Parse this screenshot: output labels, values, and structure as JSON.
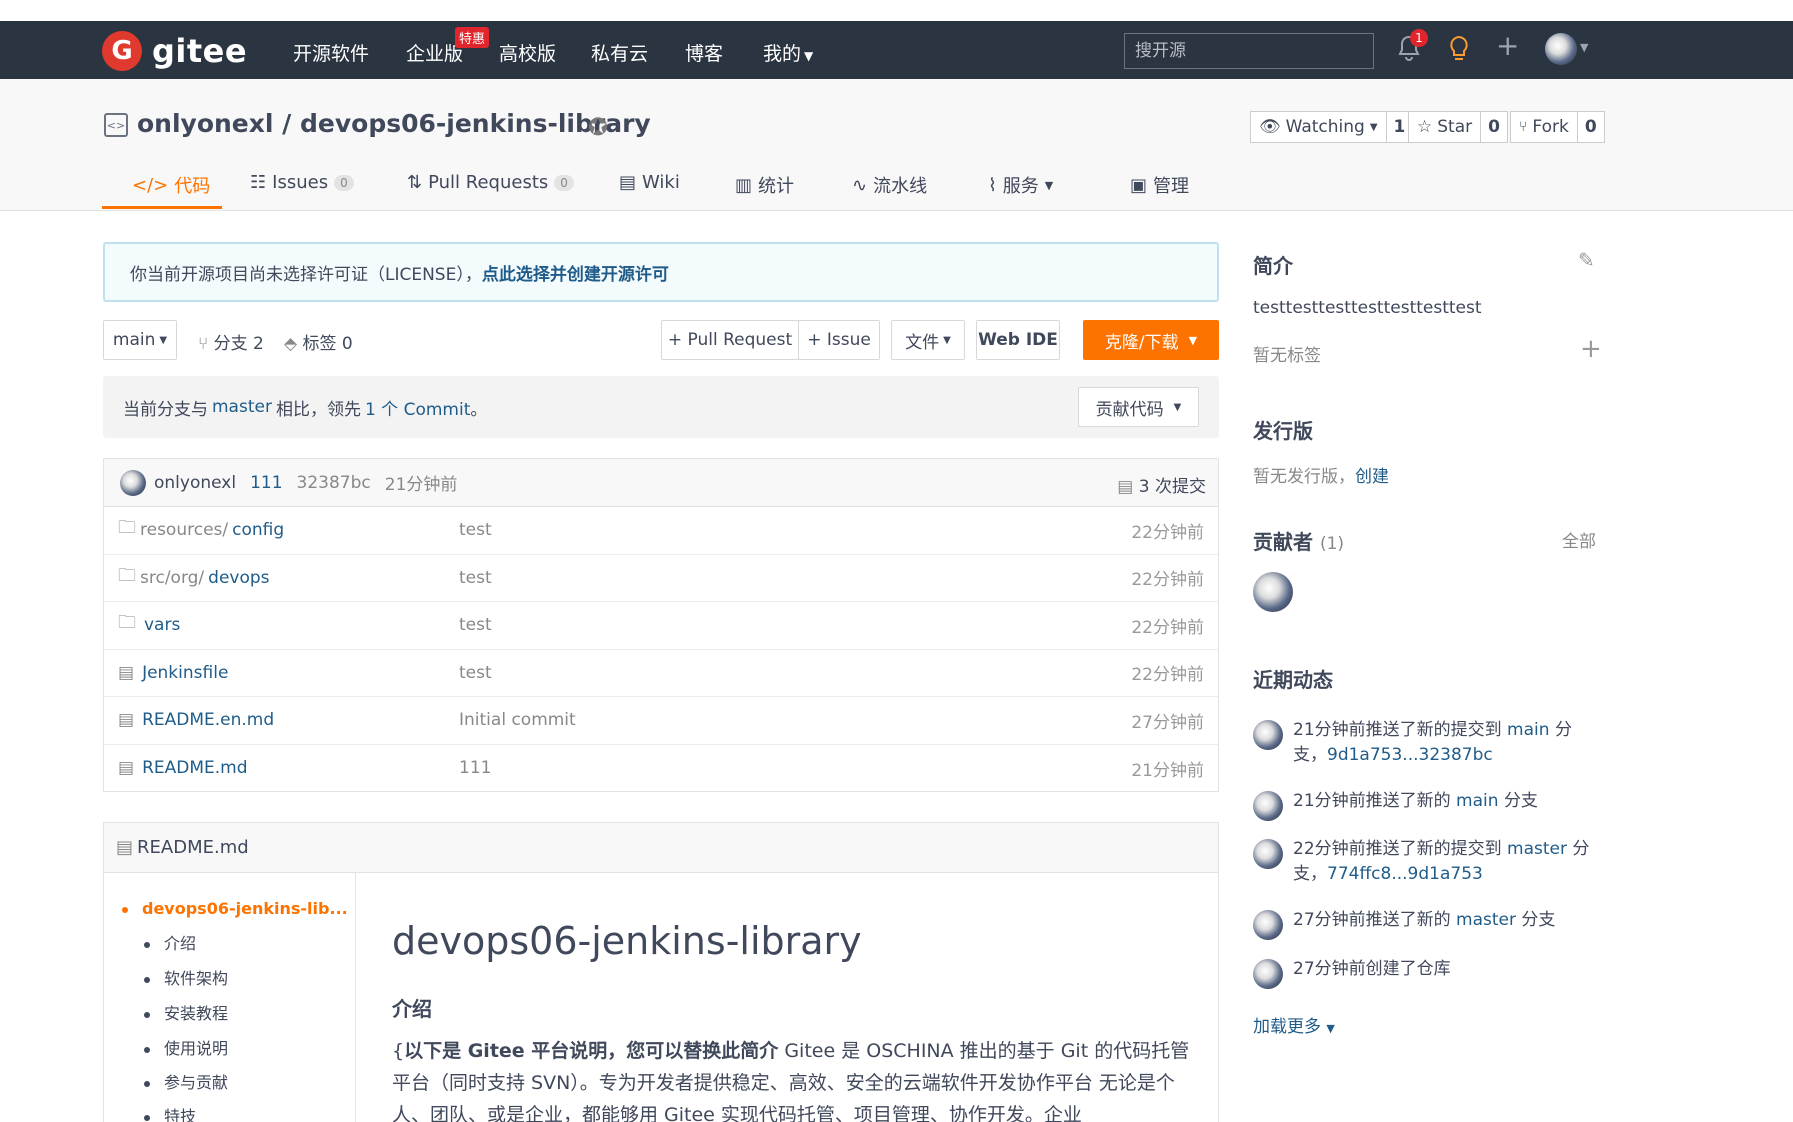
{
  "nav": {
    "logo_mark": "G",
    "logo_text": "gitee",
    "links": [
      "开源软件",
      "企业版",
      "高校版",
      "私有云",
      "博客",
      "我的"
    ],
    "enterprise_badge": "特惠",
    "search_placeholder": "搜开源",
    "notification_count": "1"
  },
  "repo": {
    "title": "onlyonexl / devops06-jenkins-library",
    "watch_label": "Watching",
    "watch_count": "1",
    "star_label": "Star",
    "star_count": "0",
    "fork_label": "Fork",
    "fork_count": "0",
    "tabs": {
      "code": "代码",
      "issues": "Issues",
      "issues_count": "0",
      "prs": "Pull Requests",
      "prs_count": "0",
      "wiki": "Wiki",
      "stats": "统计",
      "pipeline": "流水线",
      "service": "服务",
      "manage": "管理"
    }
  },
  "license_notice": {
    "text": "你当前开源项目尚未选择许可证（LICENSE），",
    "link": "点此选择并创建开源许可"
  },
  "toolbar": {
    "branch": "main",
    "branches": "分支 2",
    "tags": "标签 0",
    "pull_request": "+ Pull Request",
    "issue": "+ Issue",
    "file": "文件",
    "web_ide": "Web IDE",
    "clone": "克隆/下载"
  },
  "compare": {
    "pre": "当前分支与",
    "branch": "master",
    "mid": "相比，领先",
    "commits": "1 个 Commit",
    "post": "。",
    "contribute": "贡献代码"
  },
  "last_commit": {
    "author": "onlyonexl",
    "message": "111",
    "hash": "32387bc",
    "time": "21分钟前",
    "total": "3 次提交"
  },
  "files": [
    {
      "type": "folder",
      "name_dim": "resources/",
      "name": "config",
      "message": "test",
      "time": "22分钟前"
    },
    {
      "type": "folder",
      "name_dim": "src/org/",
      "name": "devops",
      "message": "test",
      "time": "22分钟前"
    },
    {
      "type": "folder",
      "name_dim": "",
      "name": "vars",
      "message": "test",
      "time": "22分钟前"
    },
    {
      "type": "file",
      "name_dim": "",
      "name": "Jenkinsfile",
      "message": "test",
      "time": "22分钟前"
    },
    {
      "type": "file",
      "name_dim": "",
      "name": "README.en.md",
      "message": "Initial commit",
      "time": "27分钟前"
    },
    {
      "type": "file",
      "name_dim": "",
      "name": "README.md",
      "message": "111",
      "time": "21分钟前"
    }
  ],
  "readme": {
    "filename": "README.md",
    "toc": [
      "devops06-jenkins-lib...",
      "介绍",
      "软件架构",
      "安装教程",
      "使用说明",
      "参与贡献",
      "特技"
    ],
    "h1": "devops06-jenkins-library",
    "h2": "介绍",
    "p_lead": "{",
    "p_bold": "以下是 Gitee 平台说明，您可以替换此简介",
    "p_rest": " Gitee 是 OSCHINA 推出的基于 Git 的代码托管平台（同时支持 SVN）。专为开发者提供稳定、高效、安全的云端软件开发协作平台 无论是个人、团队、或是企业，都能够用 Gitee 实现代码托管、项目管理、协作开发。企业"
  },
  "sidebar": {
    "intro_title": "简介",
    "intro_text": "testtesttesttesttesttesttest",
    "no_tags": "暂无标签",
    "release_title": "发行版",
    "no_release": "暂无发行版，",
    "create": "创建",
    "contributors_title": "贡献者",
    "contributors_count": "(1)",
    "all": "全部",
    "activity_title": "近期动态",
    "activity": [
      {
        "a": "21分钟前推送了新的提交到",
        "b": "main",
        "c": "分支，",
        "d": "9d1a753...32387bc"
      },
      {
        "a": "21分钟前推送了新的",
        "b": "main",
        "c": "分支",
        "d": ""
      },
      {
        "a": "22分钟前推送了新的提交到",
        "b": "master",
        "c": "分支，",
        "d": "774ffc8...9d1a753"
      },
      {
        "a": "27分钟前推送了新的",
        "b": "master",
        "c": "分支",
        "d": ""
      },
      {
        "a": "27分钟前创建了仓库",
        "b": "",
        "c": "",
        "d": ""
      }
    ],
    "load_more": "加载更多"
  },
  "colors": {
    "accent": "#fe7300",
    "nav_bg": "#2b3441",
    "link": "#1f5c8a",
    "badge": "#e0262c"
  }
}
